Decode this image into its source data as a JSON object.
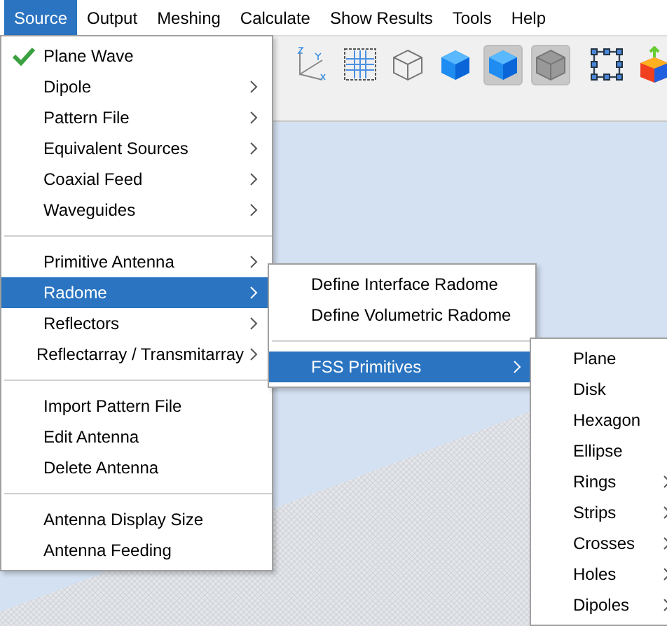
{
  "menubar": [
    {
      "label": "Source",
      "selected": true
    },
    {
      "label": "Output",
      "selected": false
    },
    {
      "label": "Meshing",
      "selected": false
    },
    {
      "label": "Calculate",
      "selected": false
    },
    {
      "label": "Show Results",
      "selected": false
    },
    {
      "label": "Tools",
      "selected": false
    },
    {
      "label": "Help",
      "selected": false
    }
  ],
  "toolbar": [
    {
      "kind": "axes",
      "pressed": false
    },
    {
      "kind": "grid",
      "pressed": false
    },
    {
      "kind": "wire-cube",
      "pressed": false
    },
    {
      "kind": "blue-cube",
      "pressed": false
    },
    {
      "kind": "blue-cube",
      "pressed": true
    },
    {
      "kind": "grey-cube",
      "pressed": true
    },
    {
      "kind": "separator"
    },
    {
      "kind": "select-frame",
      "pressed": false
    },
    {
      "kind": "color-cube",
      "pressed": false
    }
  ],
  "source_menu": [
    {
      "kind": "item",
      "label": "Plane Wave",
      "checked": true,
      "submenu": false,
      "selected": false
    },
    {
      "kind": "item",
      "label": "Dipole",
      "checked": false,
      "submenu": true,
      "selected": false
    },
    {
      "kind": "item",
      "label": "Pattern File",
      "checked": false,
      "submenu": true,
      "selected": false
    },
    {
      "kind": "item",
      "label": "Equivalent Sources",
      "checked": false,
      "submenu": true,
      "selected": false
    },
    {
      "kind": "item",
      "label": "Coaxial Feed",
      "checked": false,
      "submenu": true,
      "selected": false
    },
    {
      "kind": "item",
      "label": "Waveguides",
      "checked": false,
      "submenu": true,
      "selected": false
    },
    {
      "kind": "separator"
    },
    {
      "kind": "item",
      "label": "Primitive Antenna",
      "checked": false,
      "submenu": true,
      "selected": false
    },
    {
      "kind": "item",
      "label": "Radome",
      "checked": false,
      "submenu": true,
      "selected": true
    },
    {
      "kind": "item",
      "label": "Reflectors",
      "checked": false,
      "submenu": true,
      "selected": false
    },
    {
      "kind": "item",
      "label": "Reflectarray / Transmitarray",
      "checked": false,
      "submenu": true,
      "selected": false
    },
    {
      "kind": "separator"
    },
    {
      "kind": "item",
      "label": "Import Pattern File",
      "checked": false,
      "submenu": false,
      "selected": false
    },
    {
      "kind": "item",
      "label": "Edit Antenna",
      "checked": false,
      "submenu": false,
      "selected": false
    },
    {
      "kind": "item",
      "label": "Delete Antenna",
      "checked": false,
      "submenu": false,
      "selected": false
    },
    {
      "kind": "separator"
    },
    {
      "kind": "item",
      "label": "Antenna Display Size",
      "checked": false,
      "submenu": false,
      "selected": false
    },
    {
      "kind": "item",
      "label": "Antenna Feeding",
      "checked": false,
      "submenu": false,
      "selected": false
    }
  ],
  "radome_menu": [
    {
      "kind": "item",
      "label": "Define Interface Radome",
      "checked": false,
      "submenu": false,
      "selected": false
    },
    {
      "kind": "item",
      "label": "Define Volumetric Radome",
      "checked": false,
      "submenu": false,
      "selected": false
    },
    {
      "kind": "separator"
    },
    {
      "kind": "item",
      "label": "FSS Primitives",
      "checked": false,
      "submenu": true,
      "selected": true
    }
  ],
  "fss_menu": [
    {
      "kind": "item",
      "label": "Plane",
      "checked": false,
      "submenu": false,
      "selected": false
    },
    {
      "kind": "item",
      "label": "Disk",
      "checked": false,
      "submenu": false,
      "selected": false
    },
    {
      "kind": "item",
      "label": "Hexagon",
      "checked": false,
      "submenu": false,
      "selected": false
    },
    {
      "kind": "item",
      "label": "Ellipse",
      "checked": false,
      "submenu": false,
      "selected": false
    },
    {
      "kind": "item",
      "label": "Rings",
      "checked": false,
      "submenu": true,
      "selected": false
    },
    {
      "kind": "item",
      "label": "Strips",
      "checked": false,
      "submenu": true,
      "selected": false
    },
    {
      "kind": "item",
      "label": "Crosses",
      "checked": false,
      "submenu": true,
      "selected": false
    },
    {
      "kind": "item",
      "label": "Holes",
      "checked": false,
      "submenu": true,
      "selected": false
    },
    {
      "kind": "item",
      "label": "Dipoles",
      "checked": false,
      "submenu": true,
      "selected": false
    }
  ]
}
